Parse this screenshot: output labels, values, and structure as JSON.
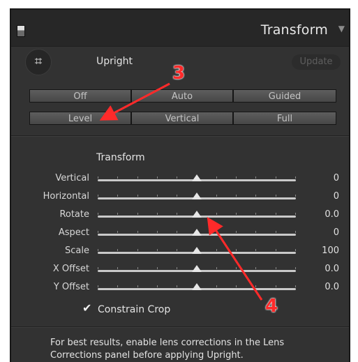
{
  "header": {
    "title": "Transform",
    "menu_icon": "triangle-down-icon"
  },
  "upright": {
    "crop_icon": "crop-grid-icon",
    "label": "Upright",
    "update_label": "Update",
    "buttons_row1": [
      "Off",
      "Auto",
      "Guided"
    ],
    "buttons_row2": [
      "Level",
      "Vertical",
      "Full"
    ]
  },
  "transform": {
    "title": "Transform",
    "sliders": [
      {
        "label": "Vertical",
        "value": "0",
        "position": 0.5
      },
      {
        "label": "Horizontal",
        "value": "0",
        "position": 0.5
      },
      {
        "label": "Rotate",
        "value": "0.0",
        "position": 0.5
      },
      {
        "label": "Aspect",
        "value": "0",
        "position": 0.5
      },
      {
        "label": "Scale",
        "value": "100",
        "position": 0.5
      },
      {
        "label": "X Offset",
        "value": "0.0",
        "position": 0.5
      },
      {
        "label": "Y Offset",
        "value": "0.0",
        "position": 0.5
      }
    ],
    "constrain_crop": {
      "label": "Constrain Crop",
      "checked": true
    }
  },
  "info": {
    "line1": "For best results, enable lens corrections in the Lens",
    "line2": "Corrections panel before applying Upright."
  },
  "annotations": {
    "color": "#ff2a2a",
    "label_a": "3",
    "label_b": "4"
  }
}
